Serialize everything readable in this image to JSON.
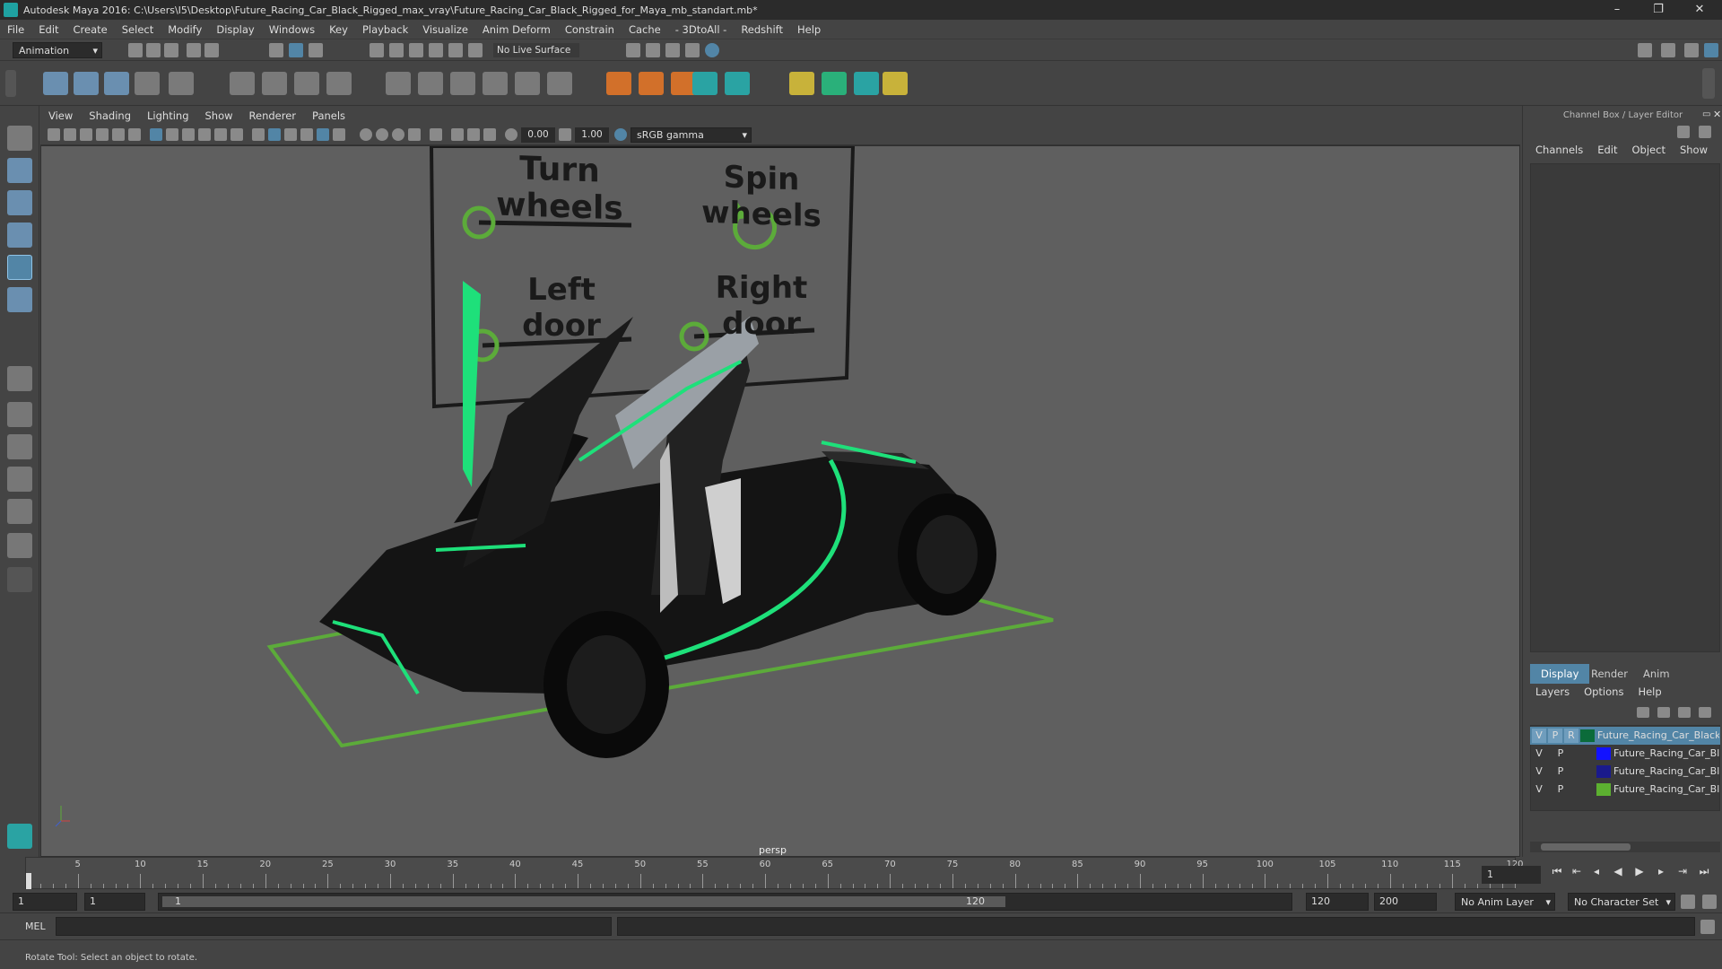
{
  "window": {
    "title": "Autodesk Maya 2016: C:\\Users\\I5\\Desktop\\Future_Racing_Car_Black_Rigged_max_vray\\Future_Racing_Car_Black_Rigged_for_Maya_mb_standart.mb*",
    "controls": [
      "–",
      "❐",
      "✕"
    ]
  },
  "menu": [
    "File",
    "Edit",
    "Create",
    "Select",
    "Modify",
    "Display",
    "Windows",
    "Key",
    "Playback",
    "Visualize",
    "Anim Deform",
    "Constrain",
    "Cache",
    "- 3DtoAll -",
    "Redshift",
    "Help"
  ],
  "status": {
    "mode": "Animation",
    "live_surface": "No Live Surface"
  },
  "viewport": {
    "menu": [
      "View",
      "Shading",
      "Lighting",
      "Show",
      "Renderer",
      "Panels"
    ],
    "exposure": "0.00",
    "gamma": "1.00",
    "color_space": "sRGB gamma",
    "camera": "persp",
    "rig_labels": {
      "turn_wheels": "Turn wheels",
      "spin_wheels": "Spin wheels",
      "left_door": "Left door",
      "right_door": "Right door"
    },
    "colors": {
      "background": "#5f5f5f",
      "control_green": "#5cab3a",
      "car_accent": "#1ee07a"
    }
  },
  "channel_box": {
    "title": "Channel Box / Layer Editor",
    "menu": [
      "Channels",
      "Edit",
      "Object",
      "Show"
    ],
    "tabs": [
      "Display",
      "Render",
      "Anim"
    ],
    "active_tab": "Display",
    "layer_menu": [
      "Layers",
      "Options",
      "Help"
    ],
    "layers": [
      {
        "v": "V",
        "p": "P",
        "r": "R",
        "color": "#0b6b3a",
        "name": "Future_Racing_Car_Black",
        "selected": true
      },
      {
        "v": "V",
        "p": "P",
        "r": "",
        "color": "#1212ff",
        "name": "Future_Racing_Car_Bla",
        "selected": false
      },
      {
        "v": "V",
        "p": "P",
        "r": "",
        "color": "#1a1a8c",
        "name": "Future_Racing_Car_Bla",
        "selected": false
      },
      {
        "v": "V",
        "p": "P",
        "r": "",
        "color": "#5cb030",
        "name": "Future_Racing_Car_Bla",
        "selected": false
      }
    ]
  },
  "timeline": {
    "ticks": [
      "5",
      "10",
      "15",
      "20",
      "25",
      "30",
      "35",
      "40",
      "45",
      "50",
      "55",
      "60",
      "65",
      "70",
      "75",
      "80",
      "85",
      "90",
      "95",
      "100",
      "105",
      "110",
      "115",
      "120"
    ],
    "start_tick": "1",
    "current_frame": "1",
    "range_start": "1",
    "range_inner_start": "1",
    "range_slider_start": "1",
    "range_slider_end": "120",
    "range_end": "120",
    "anim_end": "200",
    "anim_layer": "No Anim Layer",
    "character_set": "No Character Set"
  },
  "command": {
    "language": "MEL"
  },
  "help_line": "Rotate Tool: Select an object to rotate."
}
